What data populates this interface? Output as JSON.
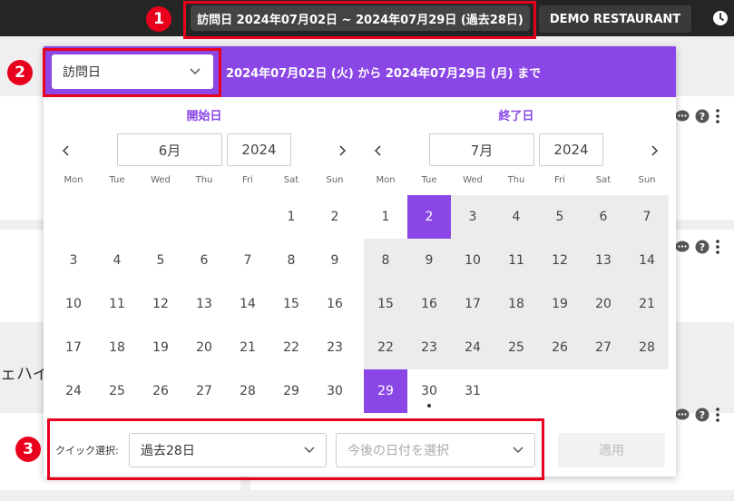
{
  "topbar": {
    "date_range_label": "訪問日 2024年07月02日 ~ 2024年07月29日 (過去28日)",
    "restaurant_label": "DEMO RESTAURANT",
    "clock_icon": "clock-icon"
  },
  "popup": {
    "date_type_value": "訪問日",
    "header_text": "2024年07月02日 (火) から 2024年07月29日 (月) まで",
    "start_title": "開始日",
    "end_title": "終了日",
    "start_month": "6月",
    "start_year": "2024",
    "end_month": "7月",
    "end_year": "2024",
    "weekdays": [
      "Mon",
      "Tue",
      "Wed",
      "Thu",
      "Fri",
      "Sat",
      "Sun"
    ],
    "quick_label": "クイック選択:",
    "quick_value": "過去28日",
    "future_placeholder": "今後の日付を選択",
    "apply_label": "適用",
    "june_weeks": [
      [
        "",
        "",
        "",
        "",
        "",
        "1",
        "2"
      ],
      [
        "3",
        "4",
        "5",
        "6",
        "7",
        "8",
        "9"
      ],
      [
        "10",
        "11",
        "12",
        "13",
        "14",
        "15",
        "16"
      ],
      [
        "17",
        "18",
        "19",
        "20",
        "21",
        "22",
        "23"
      ],
      [
        "24",
        "25",
        "26",
        "27",
        "28",
        "29",
        "30"
      ]
    ],
    "july_weeks": [
      [
        "1",
        "2",
        "3",
        "4",
        "5",
        "6",
        "7"
      ],
      [
        "8",
        "9",
        "10",
        "11",
        "12",
        "13",
        "14"
      ],
      [
        "15",
        "16",
        "17",
        "18",
        "19",
        "20",
        "21"
      ],
      [
        "22",
        "23",
        "24",
        "25",
        "26",
        "27",
        "28"
      ],
      [
        "29",
        "30",
        "31",
        "",
        "",
        "",
        ""
      ]
    ],
    "range_start": "2",
    "range_end": "29",
    "today": "30"
  },
  "background": {
    "partial_text": "ェハイ"
  },
  "annotations": [
    "1",
    "2",
    "3"
  ],
  "colors": {
    "accent": "#8b47e6",
    "topbar": "#252525",
    "annotation_red": "#e8001c"
  }
}
